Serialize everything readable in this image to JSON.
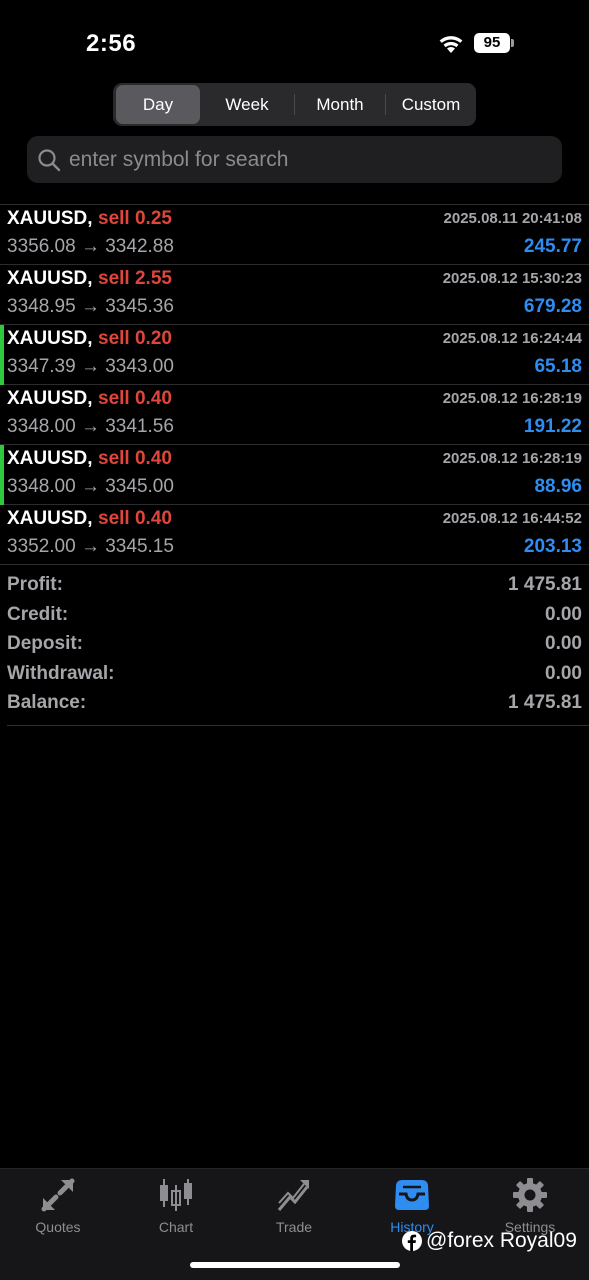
{
  "status_bar": {
    "time": "2:56",
    "battery": "95"
  },
  "segments": {
    "day": "Day",
    "week": "Week",
    "month": "Month",
    "custom": "Custom",
    "selected": "Day"
  },
  "search": {
    "placeholder": "enter symbol for search"
  },
  "deals": [
    {
      "symbol": "XAUUSD,",
      "side": "sell 0.25",
      "time": "2025.08.11 20:41:08",
      "prices": "3356.08 → 3342.88",
      "profit": "245.77",
      "marked": false
    },
    {
      "symbol": "XAUUSD,",
      "side": "sell 2.55",
      "time": "2025.08.12 15:30:23",
      "prices": "3348.95 → 3345.36",
      "profit": "679.28",
      "marked": false
    },
    {
      "symbol": "XAUUSD,",
      "side": "sell 0.20",
      "time": "2025.08.12 16:24:44",
      "prices": "3347.39 → 3343.00",
      "profit": "65.18",
      "marked": true
    },
    {
      "symbol": "XAUUSD,",
      "side": "sell 0.40",
      "time": "2025.08.12 16:28:19",
      "prices": "3348.00 → 3341.56",
      "profit": "191.22",
      "marked": false
    },
    {
      "symbol": "XAUUSD,",
      "side": "sell 0.40",
      "time": "2025.08.12 16:28:19",
      "prices": "3348.00 → 3345.00",
      "profit": "88.96",
      "marked": true
    },
    {
      "symbol": "XAUUSD,",
      "side": "sell 0.40",
      "time": "2025.08.12 16:44:52",
      "prices": "3352.00 → 3345.15",
      "profit": "203.13",
      "marked": false
    }
  ],
  "summary": [
    {
      "label": "Profit:",
      "value": "1 475.81"
    },
    {
      "label": "Credit:",
      "value": "0.00"
    },
    {
      "label": "Deposit:",
      "value": "0.00"
    },
    {
      "label": "Withdrawal:",
      "value": "0.00"
    },
    {
      "label": "Balance:",
      "value": "1 475.81"
    }
  ],
  "tab_bar": {
    "quotes": "Quotes",
    "chart": "Chart",
    "trade": "Trade",
    "history": "History",
    "settings": "Settings",
    "active": "History"
  },
  "watermark": {
    "text": "@forex Royal09",
    "icon": "facebook-icon"
  },
  "colors": {
    "sell": "#e0443a",
    "profit": "#2f8cf0",
    "marker": "#2ec93f",
    "accent": "#2f8cf0"
  }
}
